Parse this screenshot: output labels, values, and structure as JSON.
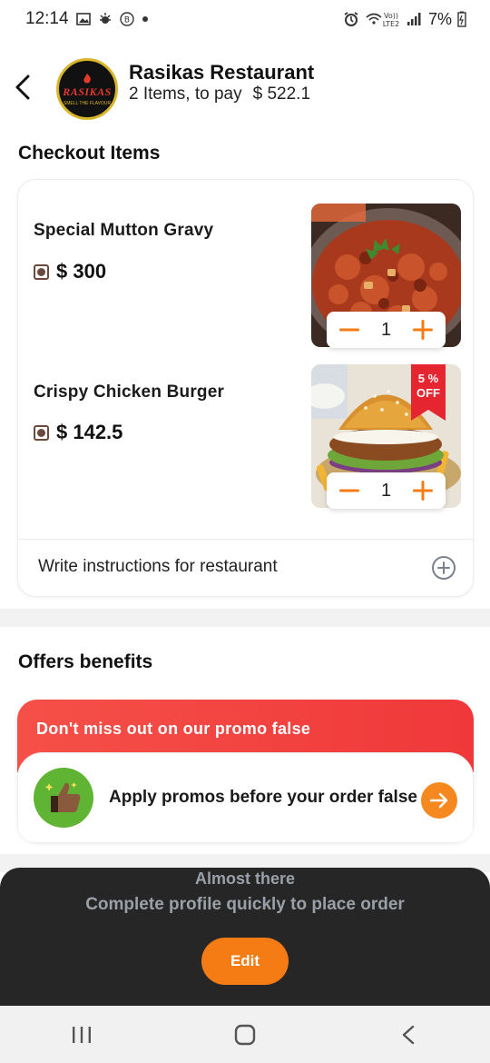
{
  "status_bar": {
    "time": "12:14",
    "network": "Vo)) LTE2",
    "battery": "7%"
  },
  "header": {
    "restaurant_name": "Rasikas Restaurant",
    "items_summary": "2  Items, to pay",
    "amount": "$ 522.1",
    "logo_word": "RASIKAS",
    "logo_tagline": "SMELL THE FLAVOUR"
  },
  "checkout": {
    "title": "Checkout Items",
    "items": [
      {
        "name": "Special Mutton Gravy",
        "price": "$ 300",
        "qty": "1",
        "badge": ""
      },
      {
        "name": "Crispy Chicken Burger",
        "price": "$ 142.5",
        "qty": "1",
        "badge": "5 % OFF"
      }
    ],
    "instructions": "Write instructions for restaurant"
  },
  "offers": {
    "title": "Offers benefits",
    "banner": "Don't miss out on our promo false",
    "apply_text": "Apply promos before your order false"
  },
  "sheet": {
    "title": "Almost there",
    "subtitle": "Complete profile quickly to place order",
    "button": "Edit"
  },
  "colors": {
    "accent": "#f57c14",
    "promo_red": "#f0383a",
    "sheet_bg": "#262626",
    "veg_mark": "#6b4a3d"
  },
  "icons": [
    "back-arrow-icon",
    "add-circle-icon",
    "thumbs-up-icon",
    "arrow-right-icon",
    "minus-icon",
    "plus-icon",
    "recents-icon",
    "home-icon",
    "back-icon"
  ]
}
